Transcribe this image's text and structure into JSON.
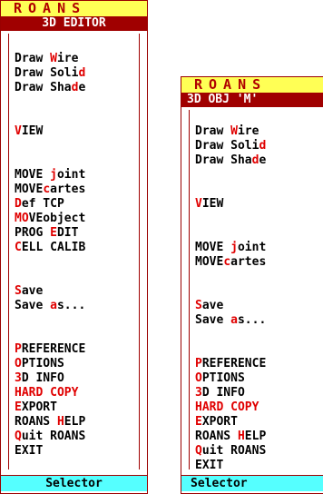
{
  "left": {
    "brand": "ROANS",
    "title": "3D EDITOR",
    "footer": "Selector",
    "items": [
      {
        "id": "draw-wire",
        "pre": "Draw ",
        "hl": "W",
        "post": "ire"
      },
      {
        "id": "draw-solid",
        "pre": "Draw Soli",
        "hl": "d",
        "post": ""
      },
      {
        "id": "draw-shade",
        "pre": "Draw Sha",
        "hl": "d",
        "post": "e"
      },
      {
        "id": "view",
        "pre": "",
        "hl": "V",
        "post": "IEW"
      },
      {
        "id": "move-joint",
        "pre": "MOVE ",
        "hl": "j",
        "post": "oint"
      },
      {
        "id": "move-cartes",
        "pre": "MOVE",
        "hl": "c",
        "post": "artes"
      },
      {
        "id": "def-tcp",
        "pre": "",
        "hl": "D",
        "post": "ef TCP"
      },
      {
        "id": "move-object",
        "pre": "",
        "hl": "MO",
        "post": "VEobject"
      },
      {
        "id": "prog-edit",
        "pre": "PROG ",
        "hl": "E",
        "post": "DIT"
      },
      {
        "id": "cell-calib",
        "pre": "",
        "hl": "C",
        "post": "ELL CALIB"
      },
      {
        "id": "save",
        "pre": "",
        "hl": "S",
        "post": "ave"
      },
      {
        "id": "save-as",
        "pre": "Save ",
        "hl": "a",
        "post": "s..."
      },
      {
        "id": "preference",
        "pre": "",
        "hl": "P",
        "post": "REFERENCE"
      },
      {
        "id": "options",
        "pre": "",
        "hl": "O",
        "post": "PTIONS"
      },
      {
        "id": "3d-info",
        "pre": "",
        "hl": "3",
        "post": "D INFO"
      },
      {
        "id": "hard-copy",
        "pre": "",
        "hl": "HARD COPY",
        "post": ""
      },
      {
        "id": "export",
        "pre": "",
        "hl": "E",
        "post": "XPORT"
      },
      {
        "id": "roans-help",
        "pre": "ROANS ",
        "hl": "H",
        "post": "ELP"
      },
      {
        "id": "quit-roans",
        "pre": "",
        "hl": "Q",
        "post": "uit ROANS"
      },
      {
        "id": "exit",
        "pre": "EXIT",
        "hl": "",
        "post": ""
      }
    ]
  },
  "right": {
    "brand": "ROANS",
    "title": "3D OBJ 'M'",
    "footer": "Selector",
    "items": [
      {
        "id": "draw-wire",
        "pre": "Draw ",
        "hl": "W",
        "post": "ire"
      },
      {
        "id": "draw-solid",
        "pre": "Draw Soli",
        "hl": "d",
        "post": ""
      },
      {
        "id": "draw-shade",
        "pre": "Draw Sha",
        "hl": "d",
        "post": "e"
      },
      {
        "id": "view",
        "pre": "",
        "hl": "V",
        "post": "IEW"
      },
      {
        "id": "move-joint",
        "pre": "MOVE ",
        "hl": "j",
        "post": "oint"
      },
      {
        "id": "move-cartes",
        "pre": "MOVE",
        "hl": "c",
        "post": "artes"
      },
      {
        "id": "save",
        "pre": "",
        "hl": "S",
        "post": "ave"
      },
      {
        "id": "save-as",
        "pre": "Save ",
        "hl": "a",
        "post": "s..."
      },
      {
        "id": "preference",
        "pre": "",
        "hl": "P",
        "post": "REFERENCE"
      },
      {
        "id": "options",
        "pre": "",
        "hl": "O",
        "post": "PTIONS"
      },
      {
        "id": "3d-info",
        "pre": "",
        "hl": "3",
        "post": "D INFO"
      },
      {
        "id": "hard-copy",
        "pre": "",
        "hl": "HARD COPY",
        "post": ""
      },
      {
        "id": "export",
        "pre": "",
        "hl": "E",
        "post": "XPORT"
      },
      {
        "id": "roans-help",
        "pre": "ROANS ",
        "hl": "H",
        "post": "ELP"
      },
      {
        "id": "quit-roans",
        "pre": "",
        "hl": "Q",
        "post": "uit ROANS"
      },
      {
        "id": "exit",
        "pre": "EXIT",
        "hl": "",
        "post": ""
      }
    ]
  },
  "colors": {
    "brand_bg": "#ffff55",
    "brand_text": "#b00000",
    "title_bg": "#a00000",
    "hotkey": "#e00000",
    "footer_bg": "#55ffff"
  }
}
